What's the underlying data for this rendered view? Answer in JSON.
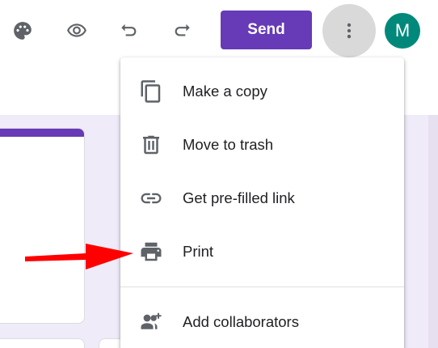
{
  "toolbar": {
    "icons": [
      "palette-icon",
      "eye-icon",
      "undo-icon",
      "redo-icon"
    ],
    "send_label": "Send",
    "more_icon": "more-vert-icon",
    "avatar_initial": "M"
  },
  "menu": {
    "items": [
      {
        "label": "Make a copy",
        "icon": "copy-icon"
      },
      {
        "label": "Move to trash",
        "icon": "trash-icon"
      },
      {
        "label": "Get pre-filled link",
        "icon": "link-icon"
      },
      {
        "label": "Print",
        "icon": "print-icon"
      },
      {
        "label": "Add collaborators",
        "icon": "add-people-icon"
      }
    ]
  },
  "colors": {
    "accent": "#673ab7",
    "avatar": "#00897b",
    "background": "#f0ebf8",
    "annotation_arrow": "#ff0000"
  }
}
